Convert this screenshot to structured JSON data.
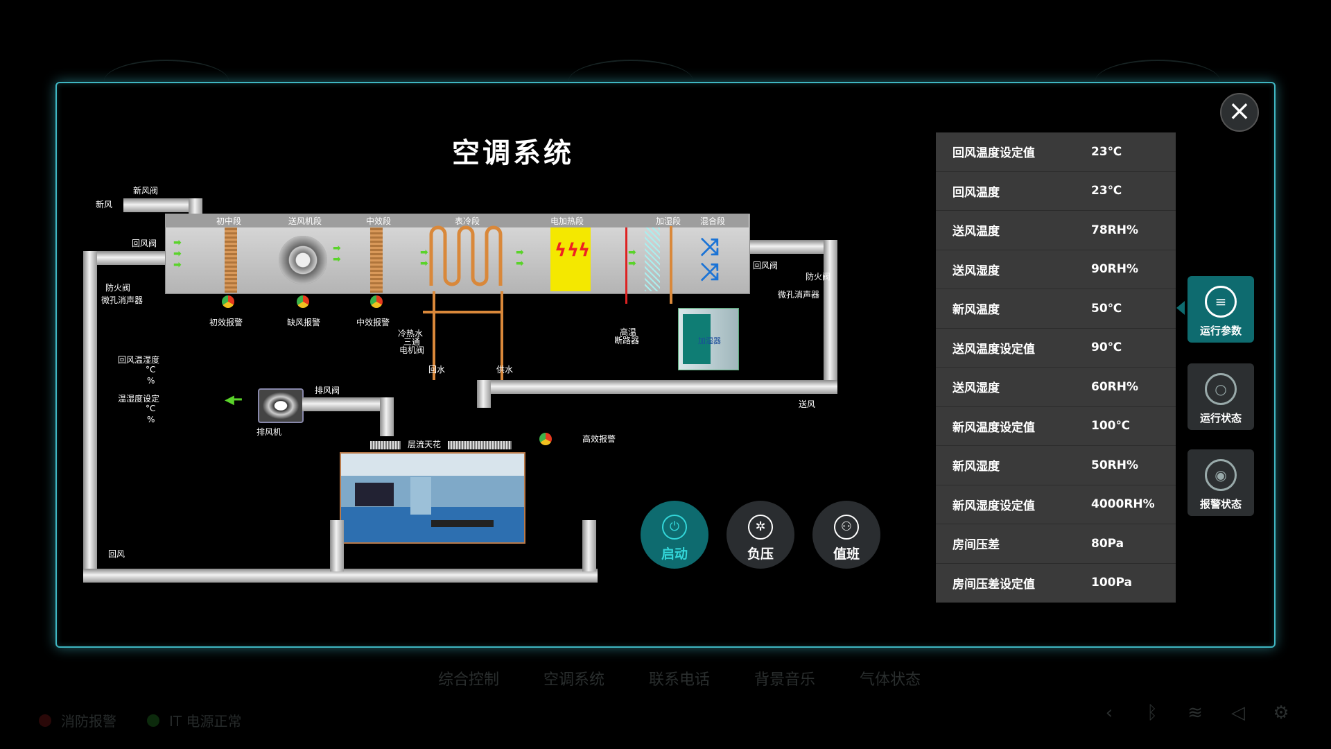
{
  "title": "空调系统",
  "diagram": {
    "labels": {
      "xinfeng": "新风",
      "xinfengfa": "新风阀",
      "huifengfa_l": "回风阀",
      "fanghuofa_l": "防火阀",
      "weikong_l": "微孔消声器",
      "chuzhong": "初中段",
      "songfengji": "送风机段",
      "zhongxiao": "中效段",
      "biaoleng": "表冷段",
      "dianjiare": "电加热段",
      "jiashi": "加湿段",
      "hunhe": "混合段",
      "huifengfa_r": "回风阀",
      "fanghuofa_r": "防火阀",
      "weikong_r": "微孔消声器",
      "chuxiao_alarm": "初效报警",
      "quefeng_alarm": "缺风报警",
      "zhongxiao_alarm": "中效报警",
      "lengreshui": "冷热水",
      "santong": "三通",
      "dianjifa": "电机阀",
      "huishui": "回水",
      "gongshui": "供水",
      "gaowen": "高温",
      "duanluqi": "断路器",
      "humidifier": "加湿器",
      "huifeng_temp": "回风温湿度",
      "unit_c1": "°C",
      "unit_p1": "%",
      "temp_set": "温湿度设定",
      "unit_c2": "°C",
      "unit_p2": "%",
      "paifengfa": "排风阀",
      "paifengji": "排风机",
      "cengliu": "层流天花",
      "gaoxiao_alarm": "高效报警",
      "songfeng": "送风",
      "huifeng": "回风"
    }
  },
  "controls": [
    {
      "label": "启动",
      "icon": "power-icon"
    },
    {
      "label": "负压",
      "icon": "fan-icon"
    },
    {
      "label": "值班",
      "icon": "user-settings-icon"
    }
  ],
  "params": [
    {
      "name": "回风温度设定值",
      "value": "23℃"
    },
    {
      "name": "回风温度",
      "value": "23℃"
    },
    {
      "name": "送风温度",
      "value": "78RH%"
    },
    {
      "name": "送风湿度",
      "value": "90RH%"
    },
    {
      "name": "新风温度",
      "value": "50℃"
    },
    {
      "name": "送风温度设定值",
      "value": "90℃"
    },
    {
      "name": "送风湿度",
      "value": "60RH%"
    },
    {
      "name": "新风温度设定值",
      "value": "100℃"
    },
    {
      "name": "新风湿度",
      "value": "50RH%"
    },
    {
      "name": "新风湿度设定值",
      "value": "4000RH%"
    },
    {
      "name": "房间压差",
      "value": "80Pa"
    },
    {
      "name": "房间压差设定值",
      "value": "100Pa"
    }
  ],
  "side_tabs": [
    {
      "label": "运行参数",
      "icon": "list-cycle-icon"
    },
    {
      "label": "运行状态",
      "icon": "ring-icon"
    },
    {
      "label": "报警状态",
      "icon": "broadcast-icon"
    }
  ],
  "bottom_nav": [
    "综合控制",
    "空调系统",
    "联系电话",
    "背景音乐",
    "气体状态"
  ],
  "status": {
    "fire": "消防报警",
    "it": "IT 电源正常"
  },
  "colors": {
    "accent": "#3fb6c2",
    "active": "#0e6b6f",
    "active_text": "#33d6d9",
    "panel": "#3a3a3a"
  }
}
